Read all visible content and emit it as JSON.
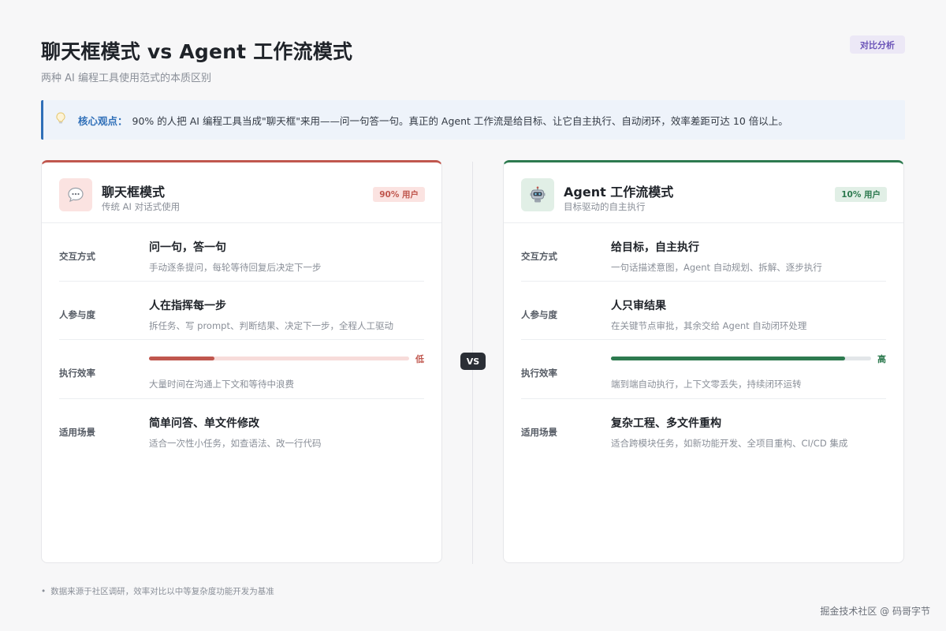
{
  "header": {
    "title": "聊天框模式 vs Agent 工作流模式",
    "subtitle": "两种 AI 编程工具使用范式的本质区别",
    "tag": "对比分析"
  },
  "callout": {
    "icon": "lightbulb-icon",
    "lead": "核心观点：",
    "text": "90% 的人把 AI 编程工具当成\"聊天框\"来用——问一句答一句。真正的 Agent 工作流是给目标、让它自主执行、自动闭环，效率差距可达 10 倍以上。"
  },
  "vs_label": "VS",
  "cards": {
    "chat": {
      "icon": "speech-bubble-icon",
      "title": "聊天框模式",
      "subtitle": "传统 AI 对话式使用",
      "badge": "90% 用户",
      "accent": "#c0574e",
      "rows": {
        "interaction": {
          "label": "交互方式",
          "head": "问一句，答一句",
          "desc": "手动逐条提问，每轮等待回复后决定下一步"
        },
        "involvement": {
          "label": "人参与度",
          "head": "人在指挥每一步",
          "desc": "拆任务、写 prompt、判断结果、决定下一步，全程人工驱动"
        },
        "efficiency": {
          "label": "执行效率",
          "level": "低",
          "value": 0.25,
          "desc": "大量时间在沟通上下文和等待中浪费"
        },
        "scenario": {
          "label": "适用场景",
          "head": "简单问答、单文件修改",
          "desc": "适合一次性小任务，如查语法、改一行代码"
        }
      }
    },
    "agent": {
      "icon": "robot-icon",
      "title": "Agent 工作流模式",
      "subtitle": "目标驱动的自主执行",
      "badge": "10% 用户",
      "accent": "#2d7a4f",
      "rows": {
        "interaction": {
          "label": "交互方式",
          "head": "给目标，自主执行",
          "desc": "一句话描述意图，Agent 自动规划、拆解、逐步执行"
        },
        "involvement": {
          "label": "人参与度",
          "head": "人只审结果",
          "desc": "在关键节点审批，其余交给 Agent 自动闭环处理"
        },
        "efficiency": {
          "label": "执行效率",
          "level": "高",
          "value": 0.9,
          "desc": "端到端自动执行，上下文零丢失，持续闭环运转"
        },
        "scenario": {
          "label": "适用场景",
          "head": "复杂工程、多文件重构",
          "desc": "适合跨模块任务，如新功能开发、全项目重构、CI/CD 集成"
        }
      }
    }
  },
  "footnote": "数据来源于社区调研，效率对比以中等复杂度功能开发为基准",
  "watermark": "掘金技术社区 @ 码哥字节"
}
